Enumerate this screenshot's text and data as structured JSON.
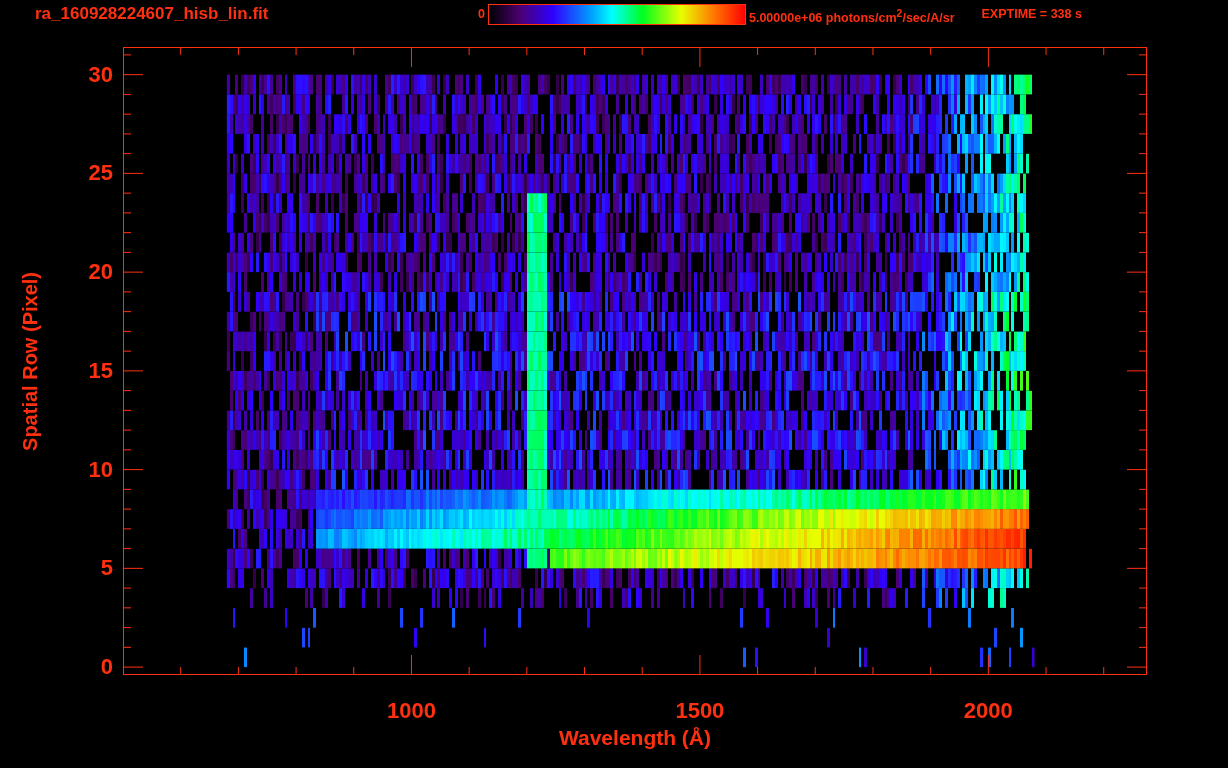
{
  "title": "ra_160928224607_hisb_lin.fit",
  "colorbar": {
    "min_label": "0",
    "max_label": "5.00000e+06 photons/cm$^{2}$/sec/A/sr"
  },
  "exposure": "EXPTIME = 338 s",
  "plot": {
    "xlabel": "Wavelength (Å)",
    "ylabel": "Spatial Row (Pixel)",
    "xtick_labels": [
      "1000",
      "1500",
      "2000"
    ],
    "ytick_labels": [
      "30",
      "25",
      "20",
      "15",
      "10",
      "5",
      "0"
    ]
  }
}
